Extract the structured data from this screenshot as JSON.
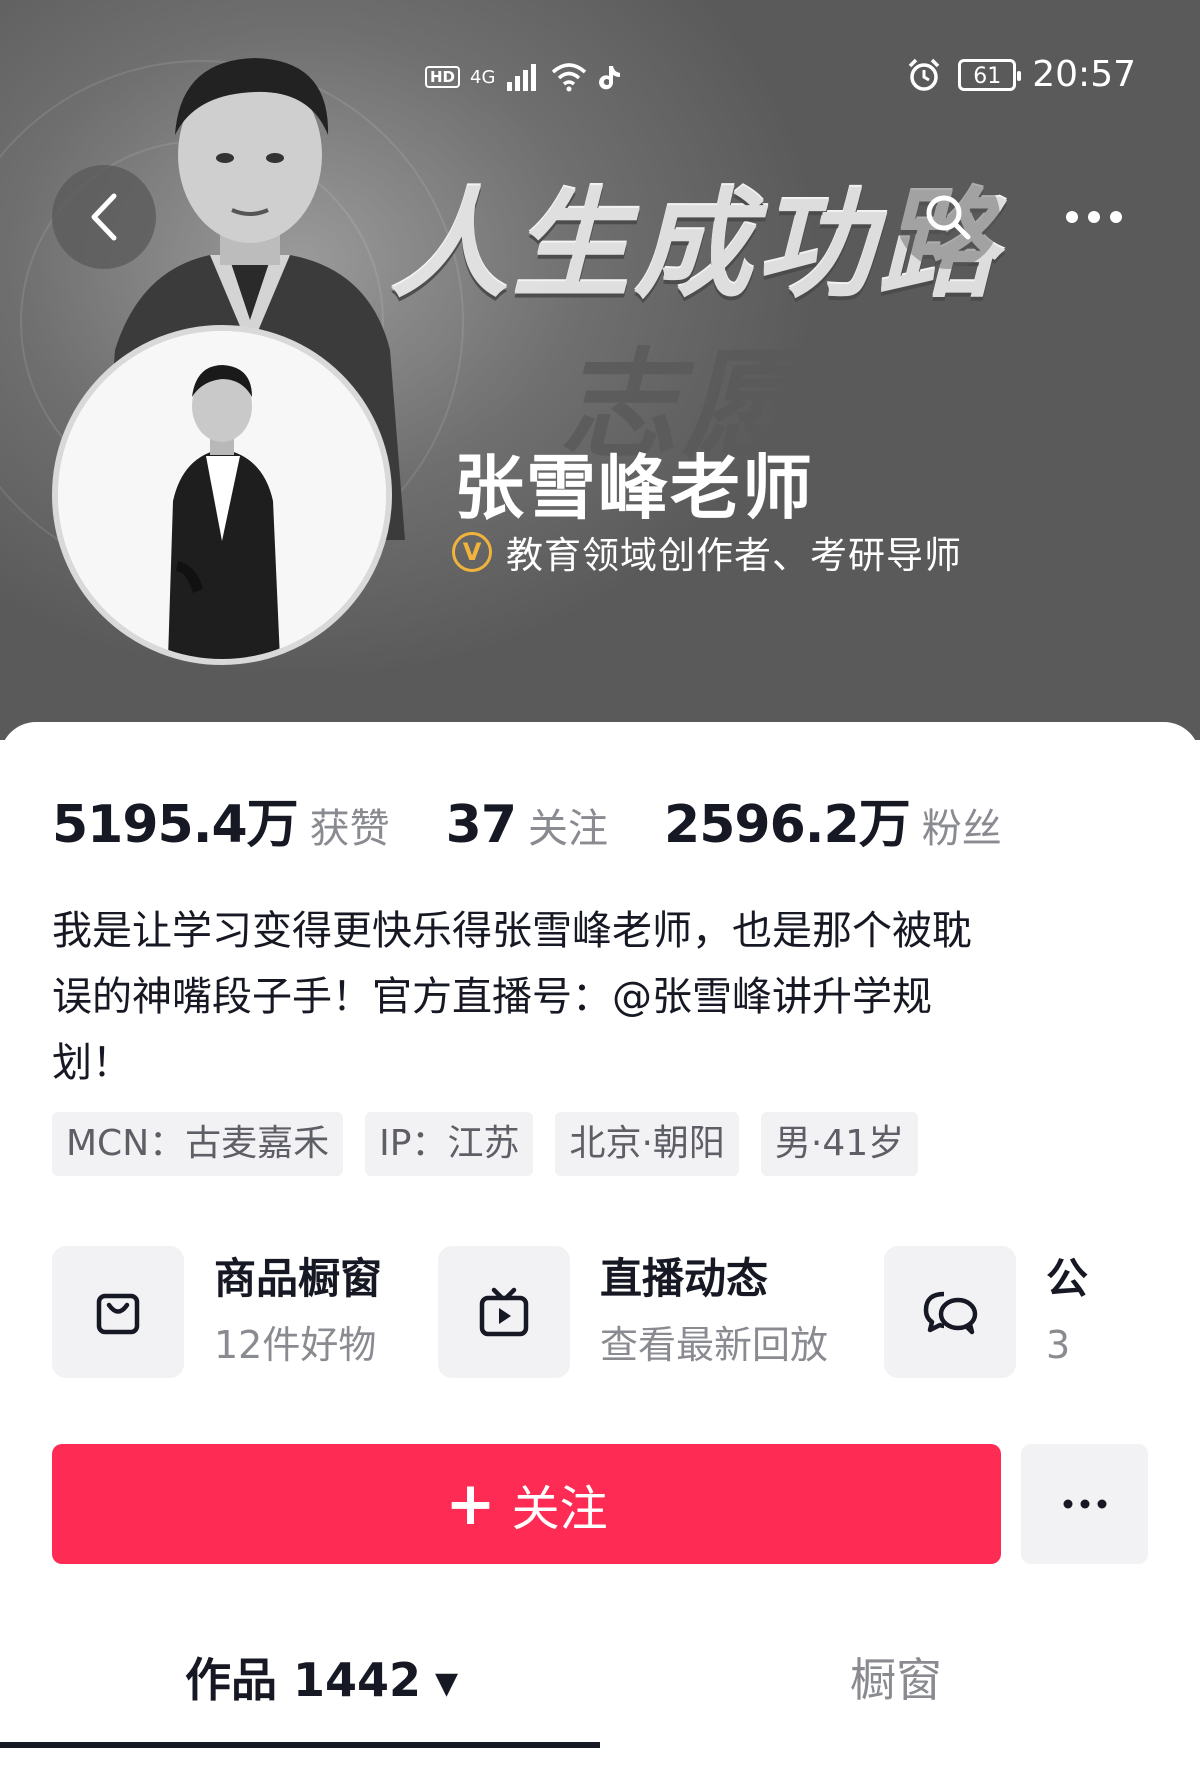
{
  "status_bar": {
    "hd": "HD",
    "network": "4G",
    "time": "20:57",
    "battery": "61"
  },
  "banner": {
    "slogan_line1": "人生成功路",
    "slogan_line2": "志愿第一步"
  },
  "profile": {
    "name": "张雪峰老师",
    "verify_badge": "V",
    "verify_text": "教育领域创作者、考研导师"
  },
  "stats": [
    {
      "value": "5195.4万",
      "label": "获赞"
    },
    {
      "value": "37",
      "label": "关注"
    },
    {
      "value": "2596.2万",
      "label": "粉丝"
    }
  ],
  "bio": [
    "我是让学习变得更快乐得张雪峰老师，也是那个被耽",
    "误的神嘴段子手！官方直播号：@张雪峰讲升学规",
    "划！"
  ],
  "tags": [
    "MCN：古麦嘉禾",
    "IP：江苏",
    "北京·朝阳",
    "男·41岁"
  ],
  "features": [
    {
      "title": "商品橱窗",
      "subtitle": "12件好物",
      "icon": "shopping-bag-icon"
    },
    {
      "title": "直播动态",
      "subtitle": "查看最新回放",
      "icon": "tv-play-icon"
    },
    {
      "title": "公",
      "subtitle": "3",
      "icon": "chat-bubbles-icon"
    }
  ],
  "actions": {
    "follow_plus": "+",
    "follow_label": "关注"
  },
  "tabs": {
    "works_label": "作品 1442",
    "works_caret": "▼",
    "window_label": "橱窗"
  },
  "colors": {
    "accent": "#fe2c55",
    "verify_gold": "#f2b33d",
    "muted_text": "#8a8b91",
    "chip_bg": "#f2f2f4"
  }
}
